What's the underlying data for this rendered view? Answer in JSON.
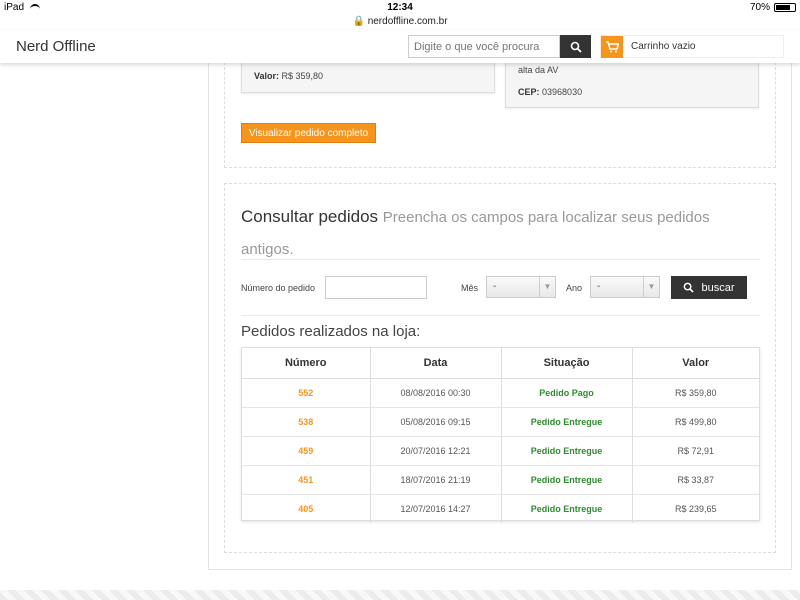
{
  "status_bar": {
    "device": "iPad",
    "time": "12:34",
    "url": "nerdoffline.com.br",
    "battery": "70%",
    "battery_level": 0.7
  },
  "header": {
    "brand": "Nerd Offline",
    "search_placeholder": "Digite o que você procura",
    "cart_label": "Carrinho vazio"
  },
  "last_order": {
    "valor_label": "Valor:",
    "valor_value": "R$ 359,80",
    "address_fragment": "alta da AV",
    "cep_label": "CEP:",
    "cep_value": "03968030",
    "view_button": "Visualizar pedido completo"
  },
  "consult": {
    "title": "Consultar pedidos",
    "subtitle": "Preencha os campos para localizar seus pedidos antigos.",
    "order_number_label": "Número do pedido",
    "month_label": "Mês",
    "month_value": "-",
    "year_label": "Ano",
    "year_value": "-",
    "search_button": "buscar"
  },
  "orders": {
    "title": "Pedidos realizados na loja:",
    "headers": [
      "Número",
      "Data",
      "Situação",
      "Valor"
    ],
    "rows": [
      {
        "numero": "552",
        "data": "08/08/2016 00:30",
        "situacao": "Pedido Pago",
        "valor": "R$ 359,80"
      },
      {
        "numero": "538",
        "data": "05/08/2016 09:15",
        "situacao": "Pedido Entregue",
        "valor": "R$ 499,80"
      },
      {
        "numero": "459",
        "data": "20/07/2016 12:21",
        "situacao": "Pedido Entregue",
        "valor": "R$ 72,91"
      },
      {
        "numero": "451",
        "data": "18/07/2016 21:19",
        "situacao": "Pedido Entregue",
        "valor": "R$ 33,87"
      },
      {
        "numero": "405",
        "data": "12/07/2016 14:27",
        "situacao": "Pedido Entregue",
        "valor": "R$ 239,65"
      }
    ]
  },
  "colors": {
    "accent": "#f7941d",
    "dark": "#333333",
    "status_green": "#2e8b2e"
  }
}
